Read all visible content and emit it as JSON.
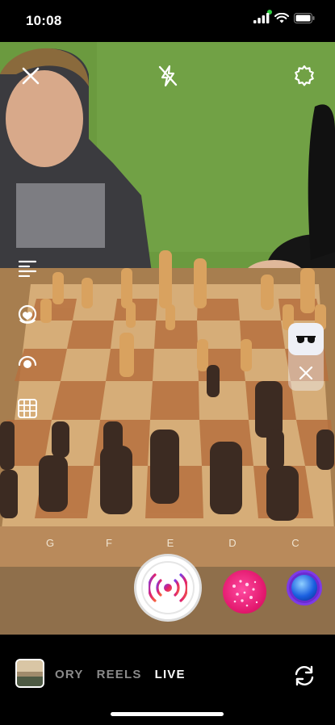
{
  "status_bar": {
    "time": "10:08"
  },
  "top_controls": {
    "close_icon": "close-icon",
    "flash_icon": "flash-off-icon",
    "settings_icon": "gear-icon"
  },
  "left_tools": [
    {
      "name": "text-align-icon"
    },
    {
      "name": "sticker-icon"
    },
    {
      "name": "touch-up-icon"
    },
    {
      "name": "layout-icon"
    }
  ],
  "right_panel": {
    "effect_icon": "glasses-icon",
    "dismiss_icon": "close-icon"
  },
  "board_labels": [
    "G",
    "F",
    "E",
    "D",
    "C"
  ],
  "capture": {
    "shutter_icon": "live-broadcast-icon"
  },
  "modes": {
    "story": "ORY",
    "reels": "REELS",
    "live": "LIVE",
    "active": "LIVE"
  },
  "colors": {
    "accent_live": "#e01f6e",
    "shutter_gradient_start": "#7b3fe4",
    "shutter_gradient_end": "#f56040"
  }
}
